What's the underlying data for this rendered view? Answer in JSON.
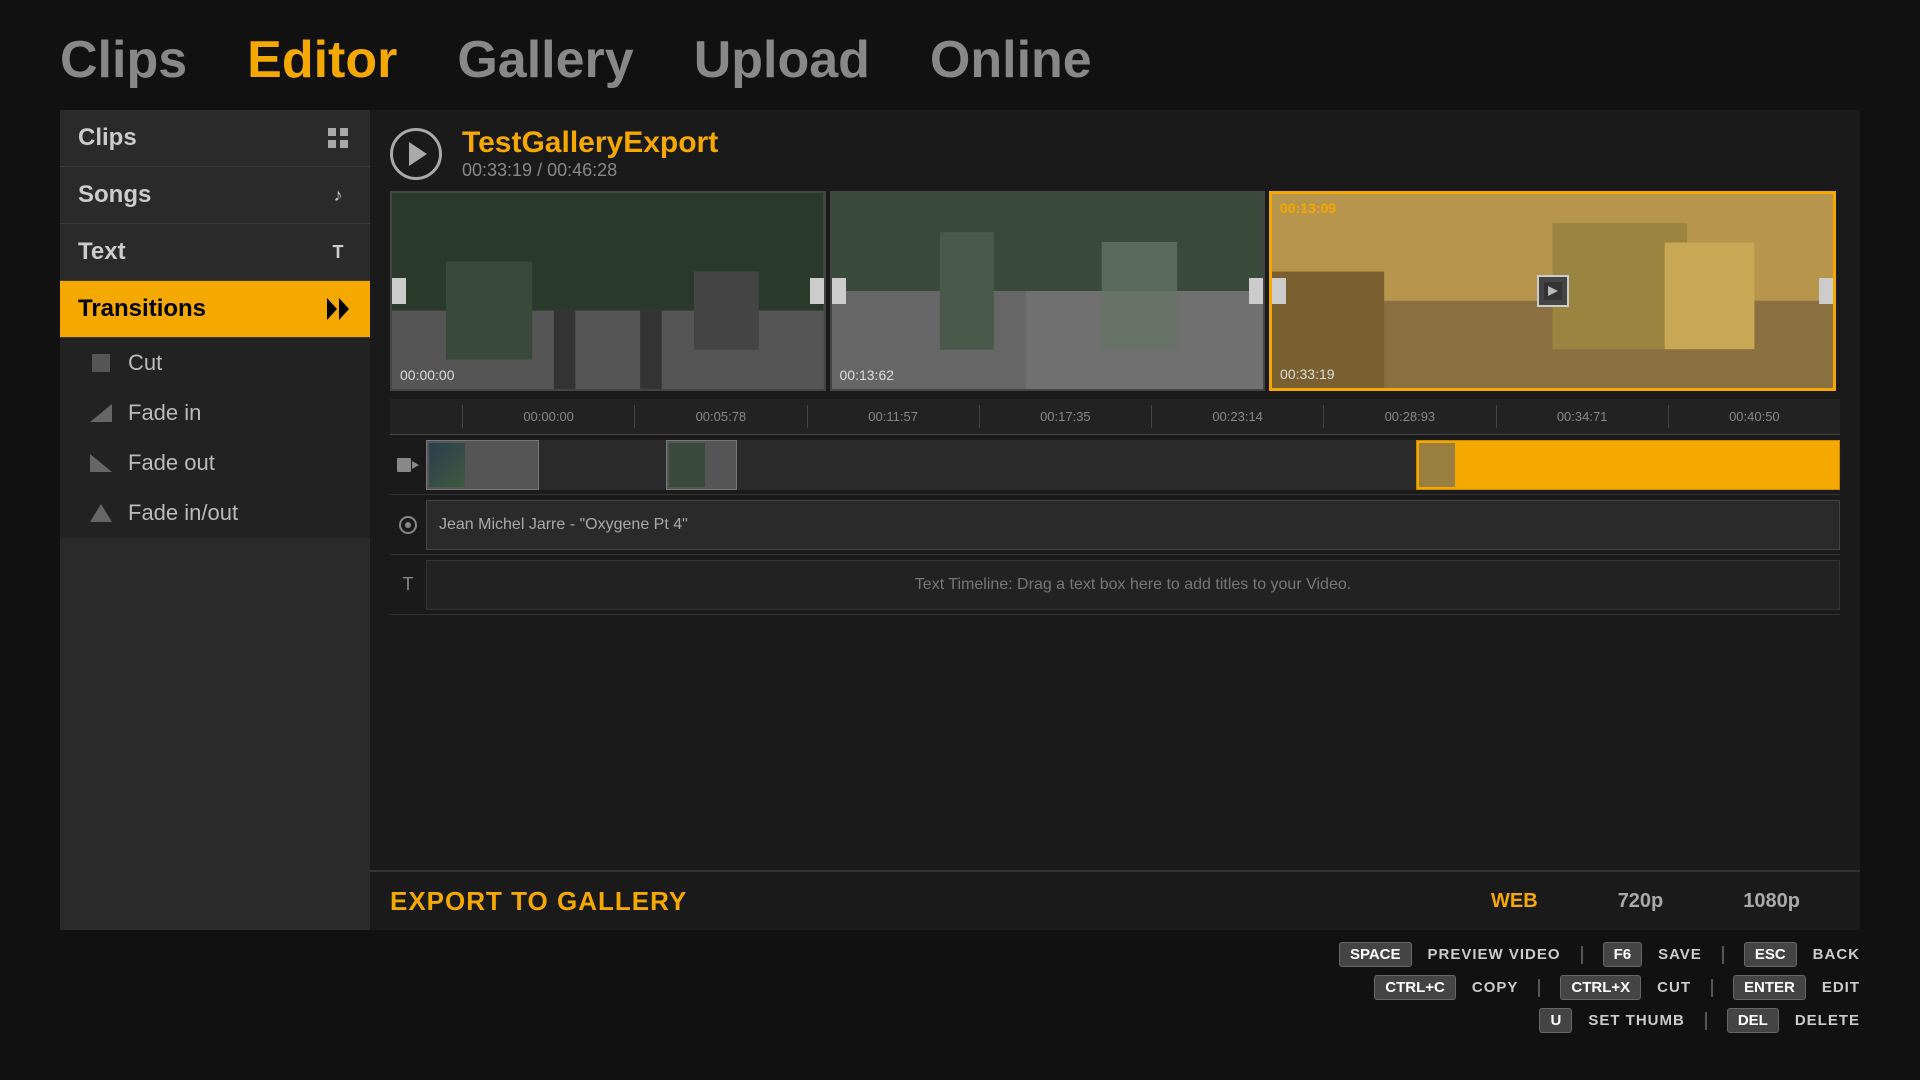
{
  "nav": {
    "items": [
      {
        "label": "Clips",
        "active": false
      },
      {
        "label": "Editor",
        "active": true
      },
      {
        "label": "Gallery",
        "active": false
      },
      {
        "label": "Upload",
        "active": false
      },
      {
        "label": "Online",
        "active": false
      }
    ]
  },
  "sidebar": {
    "items": [
      {
        "label": "Clips",
        "icon": "grid",
        "active": false
      },
      {
        "label": "Songs",
        "icon": "music",
        "active": false
      },
      {
        "label": "Text",
        "icon": "T",
        "active": false
      },
      {
        "label": "Transitions",
        "icon": "arrows",
        "active": true
      }
    ],
    "transitions": [
      {
        "label": "Cut"
      },
      {
        "label": "Fade in"
      },
      {
        "label": "Fade out"
      },
      {
        "label": "Fade in/out"
      }
    ]
  },
  "preview": {
    "project_name": "TestGalleryExport",
    "current_time": "00:33:19",
    "total_time": "00:46:28",
    "clips": [
      {
        "time_top": "",
        "time_bottom": "00:00:00",
        "selected": false
      },
      {
        "time_top": "",
        "time_bottom": "00:13:62",
        "selected": false
      },
      {
        "time_top": "00:13:09",
        "time_bottom": "00:33:19",
        "selected": true
      }
    ]
  },
  "timeline": {
    "ruler_marks": [
      "00:00:00",
      "00:05:78",
      "00:11:57",
      "00:17:35",
      "00:23:14",
      "00:28:93",
      "00:34:71",
      "00:40:50"
    ],
    "audio_track": "Jean Michel Jarre  - \"Oxygene Pt 4\"",
    "text_track_hint": "Text Timeline: Drag a text box here to add titles to your Video."
  },
  "export": {
    "button_label": "EXPORT TO GALLERY",
    "quality_options": [
      "WEB",
      "720p",
      "1080p"
    ]
  },
  "shortcuts": {
    "row1": [
      {
        "key": "SPACE",
        "label": "PREVIEW VIDEO"
      },
      {
        "key": "F6",
        "label": "SAVE"
      },
      {
        "key": "ESC",
        "label": "BACK"
      }
    ],
    "row2": [
      {
        "key": "CTRL+C",
        "label": "COPY"
      },
      {
        "key": "CTRL+X",
        "label": "CUT"
      },
      {
        "key": "ENTER",
        "label": "EDIT"
      }
    ],
    "row3": [
      {
        "key": "U",
        "label": "SET THUMB"
      },
      {
        "key": "DEL",
        "label": "DELETE"
      }
    ]
  }
}
